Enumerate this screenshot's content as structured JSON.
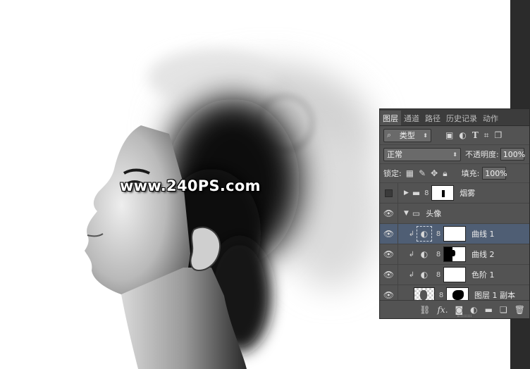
{
  "watermark": "www.240PS.com",
  "colors": {
    "panel_bg": "#535353",
    "tabbar_bg": "#3c3c3c",
    "selected_row": "#4f5e74",
    "canvas_bg": "#ffffff"
  },
  "layers_panel": {
    "tabs": [
      "图层",
      "通道",
      "路径",
      "历史记录",
      "动作"
    ],
    "filter": {
      "label": "类型",
      "icons": [
        "image-filter-icon",
        "adjustment-filter-icon",
        "text-filter-icon",
        "shape-filter-icon",
        "smart-object-filter-icon"
      ]
    },
    "blend_mode": "正常",
    "opacity_label": "不透明度:",
    "opacity_value": "100%",
    "lock_label": "锁定:",
    "fill_label": "填充:",
    "fill_value": "100%",
    "layers": [
      {
        "name": "烟雾",
        "type": "group",
        "visible": false,
        "expanded": false
      },
      {
        "name": "头像",
        "type": "group",
        "visible": true,
        "expanded": true
      },
      {
        "name": "曲线 1",
        "type": "adjustment",
        "visible": true,
        "selected": true,
        "clipped": true
      },
      {
        "name": "曲线 2",
        "type": "adjustment",
        "visible": true,
        "selected": false,
        "clipped": true
      },
      {
        "name": "色阶 1",
        "type": "adjustment",
        "visible": true,
        "selected": false,
        "clipped": true
      },
      {
        "name": "图层 1 副本",
        "type": "pixel",
        "visible": true,
        "selected": false
      }
    ],
    "footer_icons": [
      "link-layers-icon",
      "fx-icon",
      "add-mask-icon",
      "new-adjustment-icon",
      "new-group-icon",
      "new-layer-icon",
      "trash-icon"
    ],
    "fx_label": "fx."
  }
}
